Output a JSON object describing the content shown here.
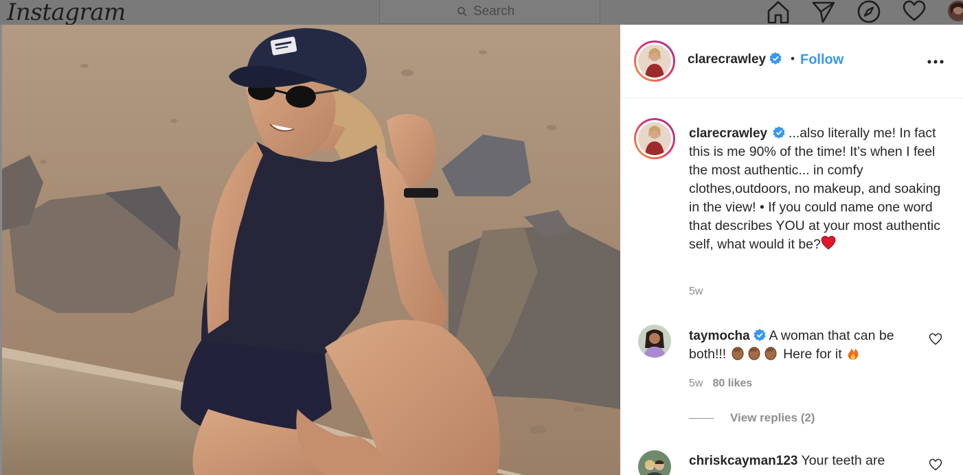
{
  "nav": {
    "logo": "Instagram",
    "search_placeholder": "Search",
    "icons": [
      "home-icon",
      "direct-icon",
      "explore-icon",
      "activity-heart-icon",
      "profile-avatar"
    ]
  },
  "post": {
    "author": "clarecrawley",
    "follow_label": "Follow",
    "separator": "•",
    "caption": "...also literally me! In fact this is me 90% of the time! It’s when I feel the most authentic... in comfy clothes,outdoors, no makeup, and soaking in the view! • If you could name one word that describes YOU at your most authentic self, what would it be?",
    "caption_time": "5w"
  },
  "comments": [
    {
      "username": "taymocha",
      "verified": true,
      "text_a": "A woman that can be both!!!",
      "text_b": "Here for it",
      "time": "5w",
      "likes": "80 likes",
      "view_replies": "View replies (2)"
    },
    {
      "username": "chriskcayman123",
      "verified": false,
      "text_a": "Your teeth are"
    }
  ],
  "colors": {
    "link_blue": "#3897f0",
    "verified_blue": "#3897f0",
    "muted_gray": "#8e8e8e",
    "overlay_gray": "#7a7a7a"
  }
}
